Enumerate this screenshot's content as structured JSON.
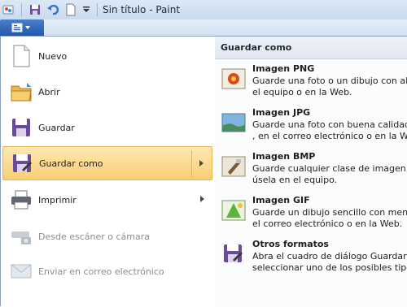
{
  "window": {
    "title": "Sin título - Paint"
  },
  "menu": {
    "items": [
      {
        "label": "Nuevo",
        "icon": "new-document-icon",
        "enabled": true,
        "selected": false,
        "submenu": false
      },
      {
        "label": "Abrir",
        "icon": "open-folder-icon",
        "enabled": true,
        "selected": false,
        "submenu": false
      },
      {
        "label": "Guardar",
        "icon": "save-floppy-icon",
        "enabled": true,
        "selected": false,
        "submenu": false
      },
      {
        "label": "Guardar como",
        "icon": "save-as-icon",
        "enabled": true,
        "selected": true,
        "submenu": true
      },
      {
        "label": "Imprimir",
        "icon": "printer-icon",
        "enabled": true,
        "selected": false,
        "submenu": true
      },
      {
        "label": "Desde escáner o cámara",
        "icon": "scanner-camera-icon",
        "enabled": false,
        "selected": false,
        "submenu": false
      },
      {
        "label": "Enviar en correo electrónico",
        "icon": "email-icon",
        "enabled": false,
        "selected": false,
        "submenu": false
      }
    ]
  },
  "submenu": {
    "header": "Guardar como",
    "items": [
      {
        "title": "Imagen PNG",
        "line1": "Guarde una foto o un dibujo con alta",
        "line2": "el equipo o en la Web.",
        "icon": "png-image-icon"
      },
      {
        "title": "Imagen JPG",
        "line1": "Guarde una foto con buena calidad y",
        "line2": ", en el correo electrónico o en la Web",
        "icon": "jpg-image-icon"
      },
      {
        "title": "Imagen BMP",
        "line1": "Guarde cualquier clase de imagen con",
        "line2": "úsela en el equipo.",
        "icon": "bmp-image-icon"
      },
      {
        "title": "Imagen GIF",
        "line1": "Guarde un dibujo sencillo con menor",
        "line2": "el correo electrónico o en la Web.",
        "icon": "gif-image-icon"
      },
      {
        "title": "Otros formatos",
        "line1": "Abra el cuadro de diálogo Guardar co",
        "line2": "seleccionar uno de los posibles tipos",
        "icon": "other-formats-icon"
      }
    ]
  },
  "colors": {
    "accent": "#1f58ae",
    "selection": "#f9cf72",
    "titlebar": "#dce8f6"
  }
}
